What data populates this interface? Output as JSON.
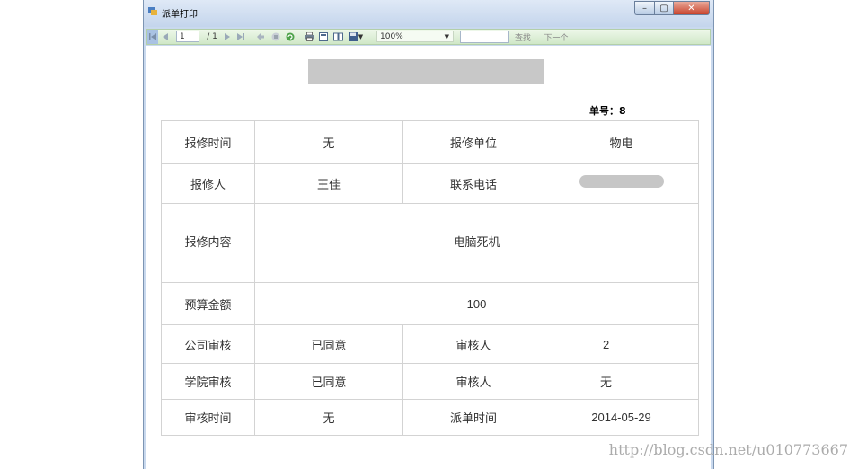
{
  "window": {
    "title": "派单打印"
  },
  "toolbar": {
    "page_current": "1",
    "page_total": "/ 1",
    "zoom": "100%",
    "search_value": "",
    "find_label": "查找",
    "next_label": "下一个"
  },
  "report": {
    "order_label": "单号：8",
    "rows": {
      "r1": {
        "l1": "报修时间",
        "v1": "无",
        "l2": "报修单位",
        "v2": "物电"
      },
      "r2": {
        "l1": "报修人",
        "v1": "王佳",
        "l2": "联系电话"
      },
      "r3": {
        "l1": "报修内容",
        "v1": "电脑死机"
      },
      "r4": {
        "l1": "预算金额",
        "v1": "100"
      },
      "r5": {
        "l1": "公司审核",
        "v1": "已同意",
        "l2": "审核人",
        "v2": "2"
      },
      "r6": {
        "l1": "学院审核",
        "v1": "已同意",
        "l2": "审核人",
        "v2": "无"
      },
      "r7": {
        "l1": "审核时间",
        "v1": "无",
        "l2": "派单时间",
        "v2": "2014-05-29"
      }
    }
  },
  "watermark": "http://blog.csdn.net/u010773667",
  "icons": {
    "close": "✕",
    "minimize": "–",
    "maximize": "▢"
  }
}
